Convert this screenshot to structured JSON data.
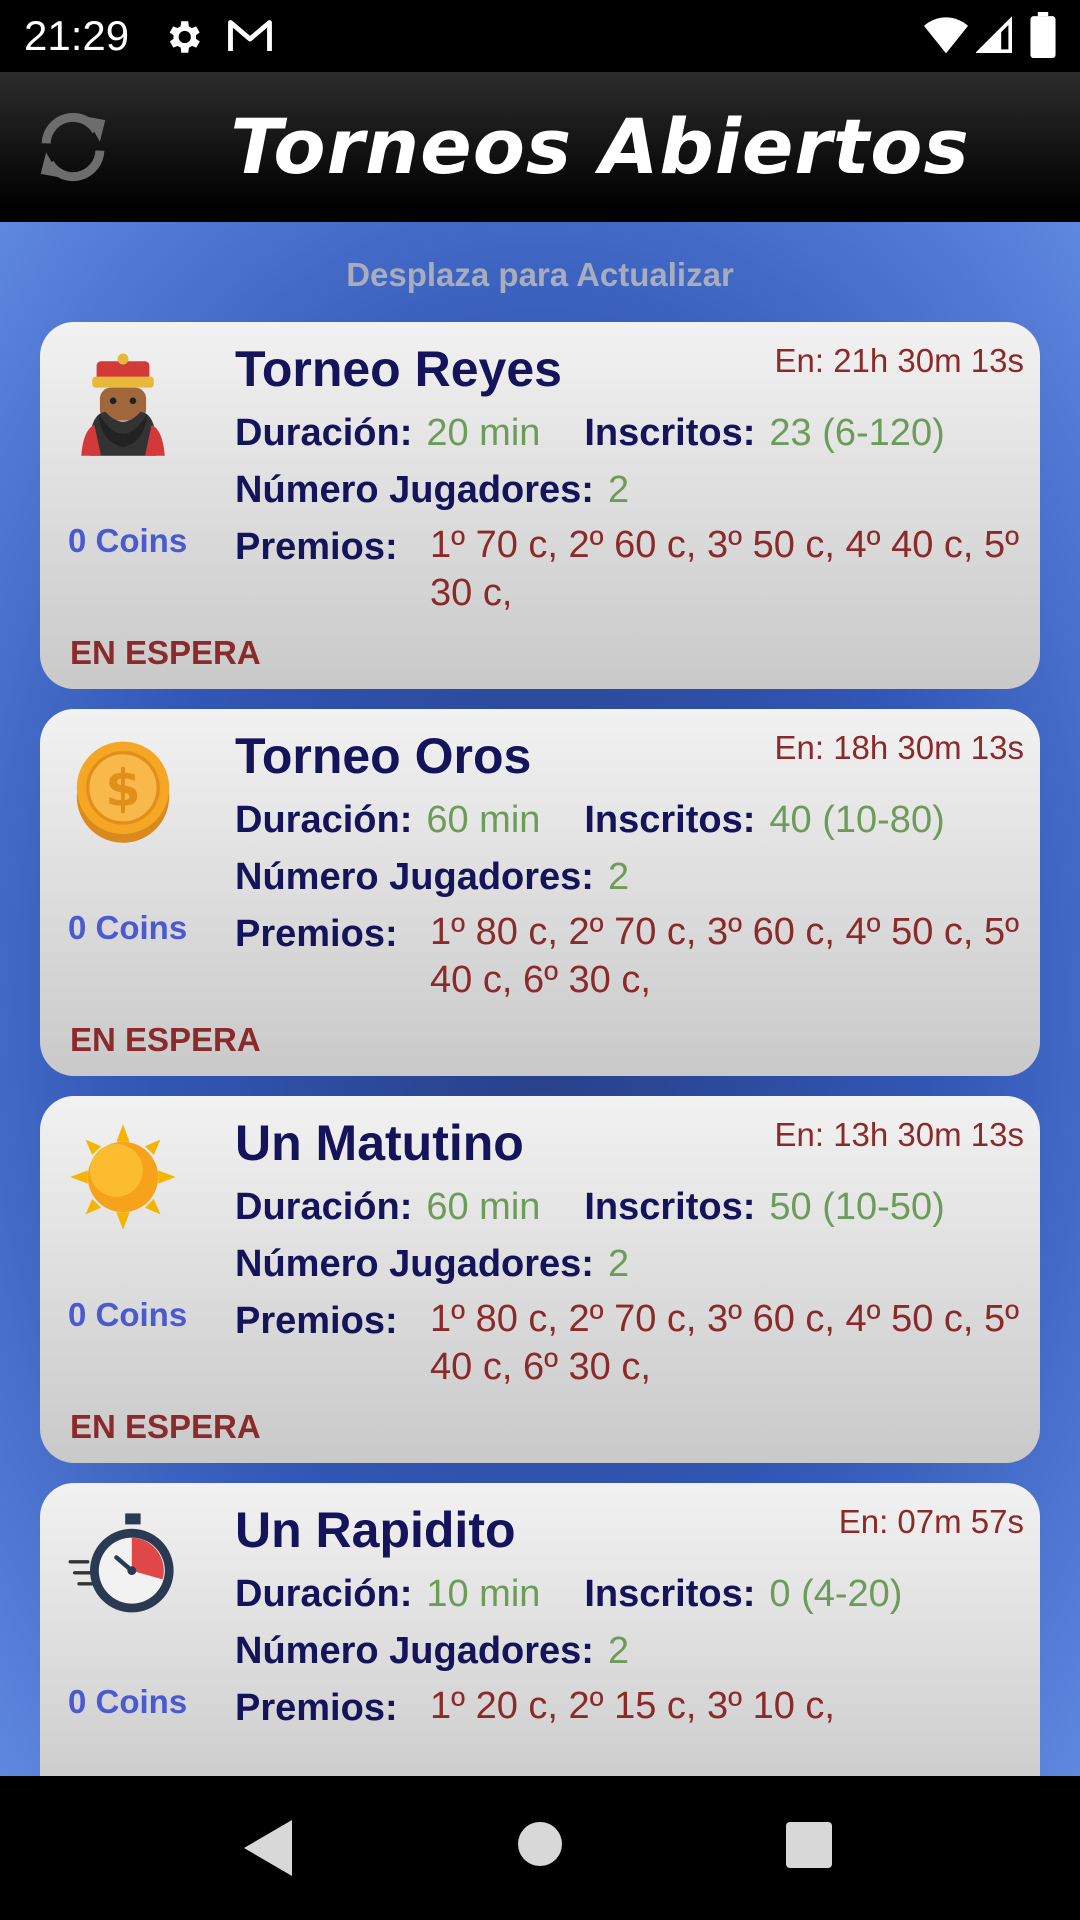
{
  "status_bar": {
    "time": "21:29",
    "icons": [
      "gear-icon",
      "gmail-icon",
      "wifi-icon",
      "signal-icon",
      "battery-icon"
    ]
  },
  "app_bar": {
    "title": "Torneos Abiertos",
    "refresh_icon": "refresh-icon"
  },
  "pull_hint": "Desplaza para Actualizar",
  "labels": {
    "duration": "Duración:",
    "enrolled": "Inscritos:",
    "players": "Número Jugadores:",
    "prizes": "Premios:"
  },
  "colors": {
    "title": "#15135a",
    "value_green": "#6d9c5a",
    "value_red": "#8b2a2a",
    "coins": "#4a5ad0"
  },
  "tournaments": [
    {
      "icon": "king-icon",
      "title": "Torneo Reyes",
      "countdown": "En: 21h 30m 13s",
      "duration": "20 min",
      "enrolled": "23 (6-120)",
      "players": "2",
      "prizes": "1º 70 c, 2º 60 c, 3º 50 c, 4º 40 c, 5º 30 c,",
      "coins": "0 Coins",
      "status": "EN ESPERA"
    },
    {
      "icon": "gold-coin-icon",
      "title": "Torneo Oros",
      "countdown": "En: 18h 30m 13s",
      "duration": "60 min",
      "enrolled": "40 (10-80)",
      "players": "2",
      "prizes": "1º 80 c, 2º 70 c, 3º 60 c, 4º 50 c, 5º 40 c, 6º 30 c,",
      "coins": "0 Coins",
      "status": "EN ESPERA"
    },
    {
      "icon": "sun-icon",
      "title": "Un Matutino",
      "countdown": "En: 13h 30m 13s",
      "duration": "60 min",
      "enrolled": "50 (10-50)",
      "players": "2",
      "prizes": "1º 80 c, 2º 70 c, 3º 60 c, 4º 50 c, 5º 40 c, 6º 30 c,",
      "coins": "0 Coins",
      "status": "EN ESPERA"
    },
    {
      "icon": "stopwatch-icon",
      "title": "Un Rapidito",
      "countdown": "En: 07m 57s",
      "duration": "10 min",
      "enrolled": "0 (4-20)",
      "players": "2",
      "prizes": "1º 20 c, 2º 15 c, 3º 10 c,",
      "coins": "0 Coins",
      "status": ""
    }
  ]
}
